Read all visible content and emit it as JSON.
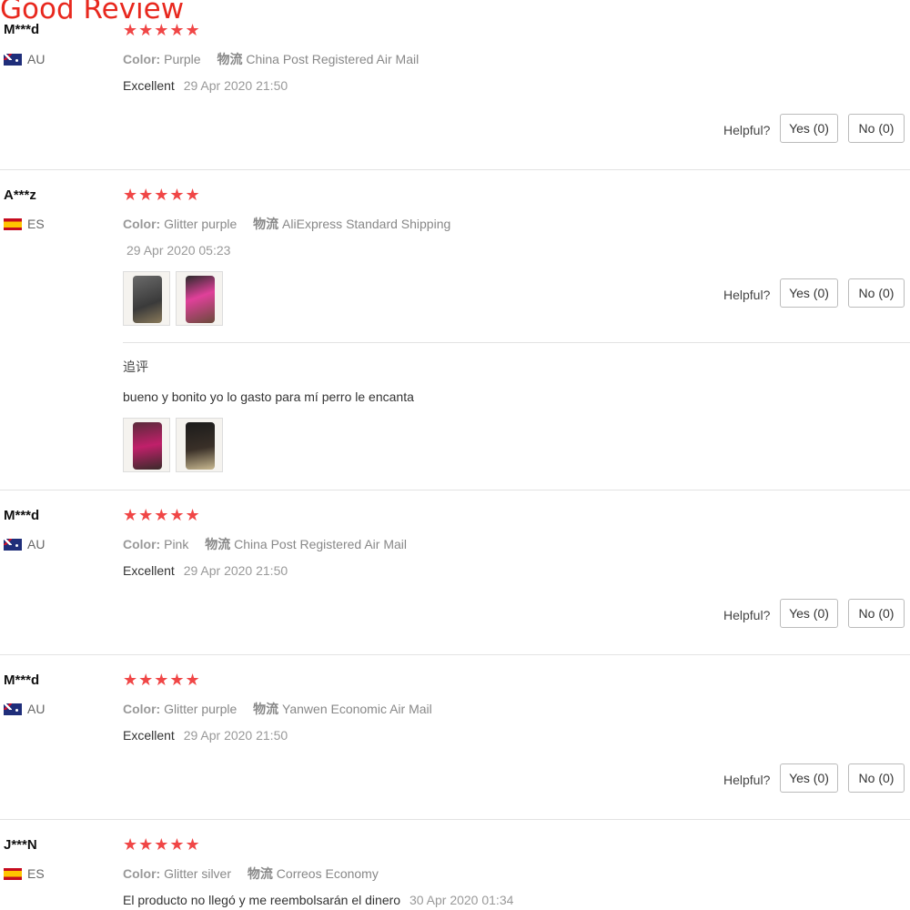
{
  "page_title": "Good Review",
  "labels": {
    "color": "Color:",
    "shipping": "物流",
    "helpful": "Helpful?",
    "yes": "Yes (0)",
    "no": "No (0)",
    "followup": "追评"
  },
  "reviews": [
    {
      "user": "M***d",
      "country": "AU",
      "stars": "★★★★★",
      "rating": 5,
      "color": "Purple",
      "shipping": "China Post Registered Air Mail",
      "feedback": "Excellent",
      "date": "29 Apr 2020 21:50"
    },
    {
      "user": "A***z",
      "country": "ES",
      "stars": "★★★★★",
      "rating": 5,
      "color": "Glitter purple",
      "shipping": "AliExpress Standard Shipping",
      "feedback": "",
      "date": "29 Apr 2020 05:23",
      "followup_text": "bueno y bonito yo lo gasto para mí perro le encanta"
    },
    {
      "user": "M***d",
      "country": "AU",
      "stars": "★★★★★",
      "rating": 5,
      "color": "Pink",
      "shipping": "China Post Registered Air Mail",
      "feedback": "Excellent",
      "date": "29 Apr 2020 21:50"
    },
    {
      "user": "M***d",
      "country": "AU",
      "stars": "★★★★★",
      "rating": 5,
      "color": "Glitter purple",
      "shipping": "Yanwen Economic Air Mail",
      "feedback": "Excellent",
      "date": "29 Apr 2020 21:50"
    },
    {
      "user": "J***N",
      "country": "ES",
      "stars": "★★★★★",
      "rating": 5,
      "color": "Glitter silver",
      "shipping": "Correos Economy",
      "feedback": "El producto no llegó y me reembolsarán el dinero",
      "date": "30 Apr 2020 01:34"
    }
  ]
}
